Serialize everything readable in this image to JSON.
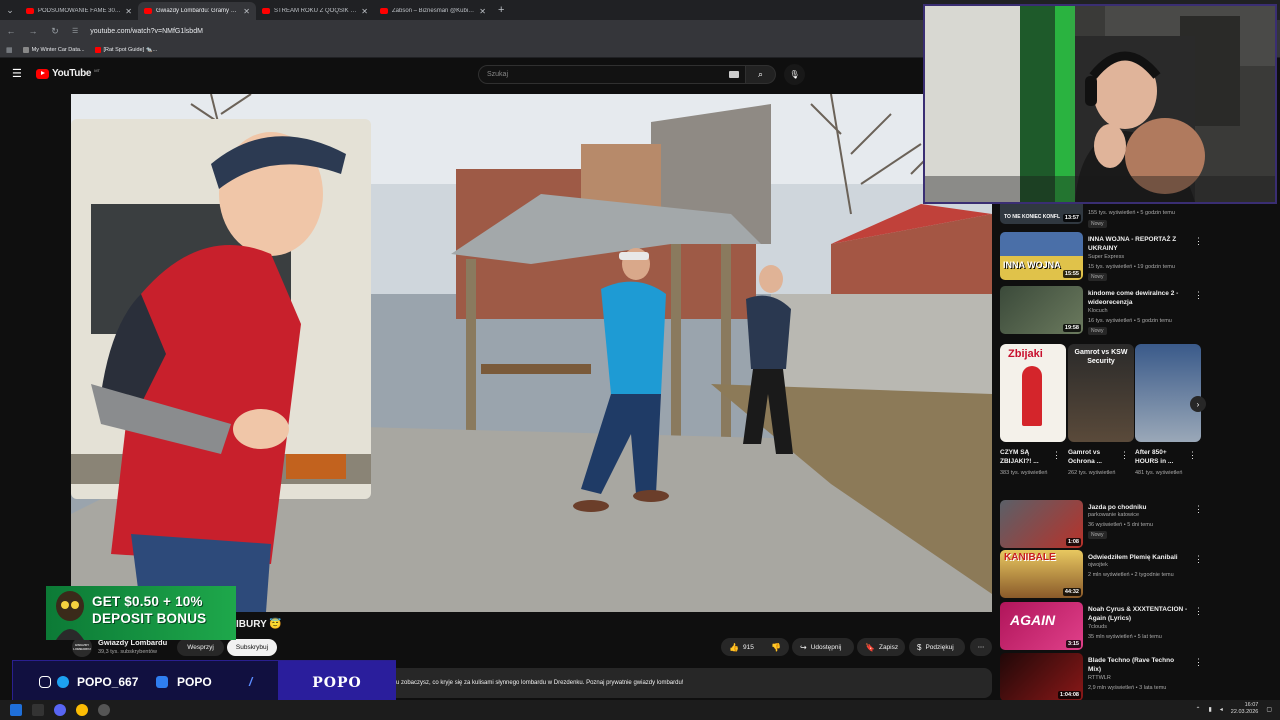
{
  "browser": {
    "tabs": [
      {
        "title": "PODSUMOWANIE FAME 30 (DJ..."
      },
      {
        "title": "Gwiazdy Lombardu: Gramy w L..."
      },
      {
        "title": "STREAM ROKU Z QOQSIK | WS..."
      },
      {
        "title": "Żabson – Biznesman @Kubi Pr..."
      }
    ],
    "url": "youtube.com/watch?v=NMfG1lsbdM",
    "bookmarks": [
      {
        "label": "My Winter Car Data..."
      },
      {
        "label": "[Rat Spot Guide] 🐀..."
      }
    ]
  },
  "youtube": {
    "logo": "YouTube",
    "region": "MT",
    "search_placeholder": "Szukaj"
  },
  "video": {
    "title_visible": "IBURY 😇",
    "channel": "Gwiazdy Lombardu",
    "channel_avatar_text": "GWIAZDY LOMBARDU",
    "subscribers": "39,3 tys. subskrybentów",
    "join_label": "Wesprzyj",
    "subscribe_label": "Subskrybuj",
    "likes": "915",
    "share_label": "Udostępnij",
    "save_label": "Zapisz",
    "thanks_label": "Podziękuj",
    "description": "ku zobaczysz, co kryje się za kulisami słynnego lombardu w Drezdenku. Poznaj prywatnie gwiazdy lombardu!"
  },
  "sidebar": {
    "top_partial": {
      "duration": "13:57",
      "thumb_text": "TO NIE KONIEC KONFL",
      "meta": "155 tys. wyświetleń • 5 godzin temu",
      "badge": "Nowy"
    },
    "videos_top": [
      {
        "title": "INNA WOJNA - REPORTAŻ Z UKRAINY",
        "channel": "Super Express",
        "meta": "15 tys. wyświetleń • 19 godzin temu",
        "duration": "15:55",
        "badge": "Nowy",
        "thumb_text": "INNA WOJNA"
      },
      {
        "title": "kindome come dewiralnce 2 - wideorecenzja",
        "channel": "Klocuch",
        "meta": "16 tys. wyświetleń • 5 godzin temu",
        "duration": "19:58",
        "badge": "Nowy"
      }
    ],
    "shorts": [
      {
        "title": "CZYM SĄ ZBIJAKI?! ...",
        "views": "383 tys. wyświetleń",
        "thumb_text": "Zbijaki"
      },
      {
        "title": "Gamrot vs Ochrona ...",
        "views": "262 tys. wyświetleń",
        "thumb_text": "Gamrot vs KSW Security"
      },
      {
        "title": "After 850+ HOURS in ...",
        "views": "481 tys. wyświetleń"
      }
    ],
    "videos_bottom": [
      {
        "title": "Jazda po chodniku",
        "channel": "parkowanie katowice",
        "meta": "36 wyświetleń • 5 dni temu",
        "duration": "1:08",
        "badge": "Nowy"
      },
      {
        "title": "Odwiedziłem Plemię Kanibali",
        "channel": "ojwojtek",
        "meta": "2 mln wyświetleń • 2 tygodnie temu",
        "duration": "44:32",
        "thumb_text": "KANIBALE"
      },
      {
        "title": "Noah Cyrus & XXXTENTACION - Again (Lyrics)",
        "channel": "7clouds",
        "meta": "35 mln wyświetleń • 5 lat temu",
        "duration": "3:15",
        "thumb_text": "AGAIN"
      },
      {
        "title": "Blade Techno (Rave Techno Mix)",
        "channel": "RTTWLR",
        "meta": "2,9 mln wyświetleń • 3 lata temu",
        "duration": "1:04:08"
      }
    ]
  },
  "overlays": {
    "promo_line1": "GET $0.50 + 10%",
    "promo_line2": "DEPOSIT BONUS",
    "social_handle1": "POPO_667",
    "social_handle2": "POPO",
    "social_name": "POPO"
  },
  "taskbar": {
    "time": "16:07",
    "date": "22.03.2026"
  },
  "colors": {
    "youtube_red": "#ff0000",
    "bg": "#0f0f0f",
    "overlay_purple": "#2a1e9c",
    "promo_green": "#1ea84b"
  }
}
